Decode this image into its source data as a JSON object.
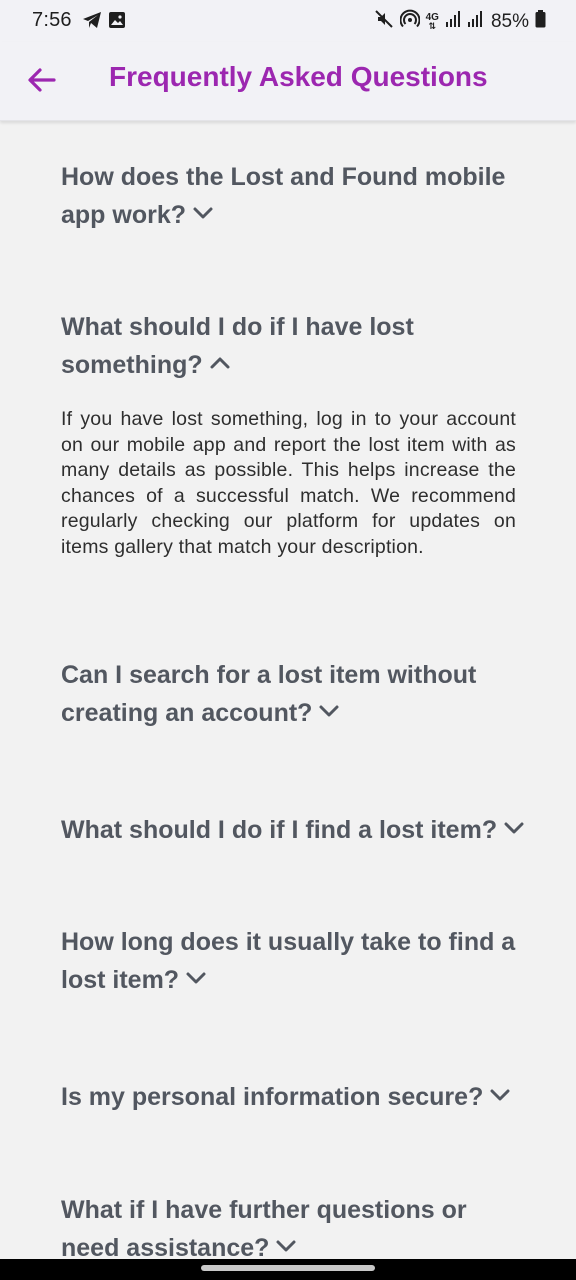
{
  "status_bar": {
    "time": "7:56",
    "battery": "85%",
    "network_type": "4G",
    "icons": [
      "telegram-icon",
      "image-icon",
      "mute-icon",
      "hotspot-icon",
      "network-4g-icon",
      "signal-icon",
      "signal-icon",
      "battery-icon"
    ]
  },
  "app_bar": {
    "title": "Frequently Asked Questions",
    "back_icon": "arrow-left-icon"
  },
  "colors": {
    "accent": "#9c27b0",
    "question_text": "#525760",
    "answer_text": "#2e2e2e",
    "background": "#f2f2f2"
  },
  "faqs": [
    {
      "question": "How does the Lost and Found mobile app work?",
      "expanded": false
    },
    {
      "question": "What should I do if I have lost something?",
      "expanded": true,
      "answer": "If you have lost something, log in to your account on our mobile app and report the lost item with as many details as possible. This helps increase the chances of a successful match. We recommend regularly checking our platform for updates on items gallery that match your description."
    },
    {
      "question": "Can I search for a lost item without creating an account?",
      "expanded": false
    },
    {
      "question": "What should I do if I find a lost item?",
      "expanded": false
    },
    {
      "question": "How long does it usually take to find a lost item?",
      "expanded": false
    },
    {
      "question": "Is my personal information secure?",
      "expanded": false
    },
    {
      "question": "What if I have further questions or need assistance?",
      "expanded": false
    }
  ]
}
